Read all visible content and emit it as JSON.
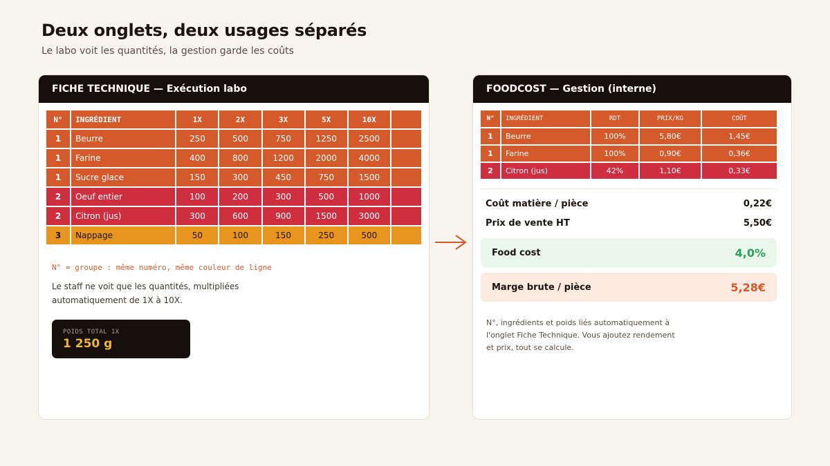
{
  "header": {
    "title": "Deux onglets, deux usages séparés",
    "subtitle": "Le labo voit les quantités, la gestion garde les coûts"
  },
  "fiche": {
    "title": "FICHE TECHNIQUE — Exécution labo",
    "columns": [
      "N°",
      "INGRÉDIENT",
      "1X",
      "2X",
      "3X",
      "5X",
      "10X",
      ""
    ],
    "rows": [
      {
        "no": "1",
        "ingredient": "Beurre",
        "q1": "250",
        "q2": "500",
        "q3": "750",
        "q5": "1250",
        "q10": "2500"
      },
      {
        "no": "1",
        "ingredient": "Farine",
        "q1": "400",
        "q2": "800",
        "q3": "1200",
        "q5": "2000",
        "q10": "4000"
      },
      {
        "no": "1",
        "ingredient": "Sucre glace",
        "q1": "150",
        "q2": "300",
        "q3": "450",
        "q5": "750",
        "q10": "1500"
      },
      {
        "no": "2",
        "ingredient": "Oeuf entier",
        "q1": "100",
        "q2": "200",
        "q3": "300",
        "q5": "500",
        "q10": "1000"
      },
      {
        "no": "2",
        "ingredient": "Citron (jus)",
        "q1": "300",
        "q2": "600",
        "q3": "900",
        "q5": "1500",
        "q10": "3000"
      },
      {
        "no": "3",
        "ingredient": "Nappage",
        "q1": "50",
        "q2": "100",
        "q3": "150",
        "q5": "250",
        "q10": "500"
      }
    ],
    "legend": "N° = groupe : même numéro, même couleur de ligne",
    "note": "Le staff ne voit que les quantités, multipliées automatiquement de 1X à 10X.",
    "weight_label": "POIDS TOTAL 1X",
    "weight_value": "1 250 g"
  },
  "foodcost": {
    "title": "FOODCOST — Gestion (interne)",
    "columns": [
      "N°",
      "INGRÉDIENT",
      "RDT",
      "PRIX/KG",
      "COÛT"
    ],
    "rows": [
      {
        "no": "1",
        "ingredient": "Beurre",
        "rdt": "100%",
        "prix": "5,80€",
        "cout": "1,45€"
      },
      {
        "no": "1",
        "ingredient": "Farine",
        "rdt": "100%",
        "prix": "0,90€",
        "cout": "0,36€"
      },
      {
        "no": "2",
        "ingredient": "Citron (jus)",
        "rdt": "42%",
        "prix": "1,10€",
        "cout": "0,33€"
      }
    ],
    "cout_matiere_label": "Coût matière / pièce",
    "cout_matiere_value": "0,22€",
    "prix_vente_label": "Prix de vente HT",
    "prix_vente_value": "5,50€",
    "food_cost_label": "Food cost",
    "food_cost_value": "4,0%",
    "marge_label": "Marge brute / pièce",
    "marge_value": "5,28€",
    "footnote": "N°, ingrédients et poids liés automatiquement à l'onglet Fiche Technique. Vous ajoutez rendement et prix, tout se calcule."
  },
  "colors": {
    "group1": "#d45a2b",
    "group2": "#cf2e3e",
    "group3": "#e8951f",
    "food_cost_green": "#2f9e58",
    "marge_orange": "#d45a2b"
  },
  "icons": {
    "arrow": "arrow-right-icon"
  }
}
